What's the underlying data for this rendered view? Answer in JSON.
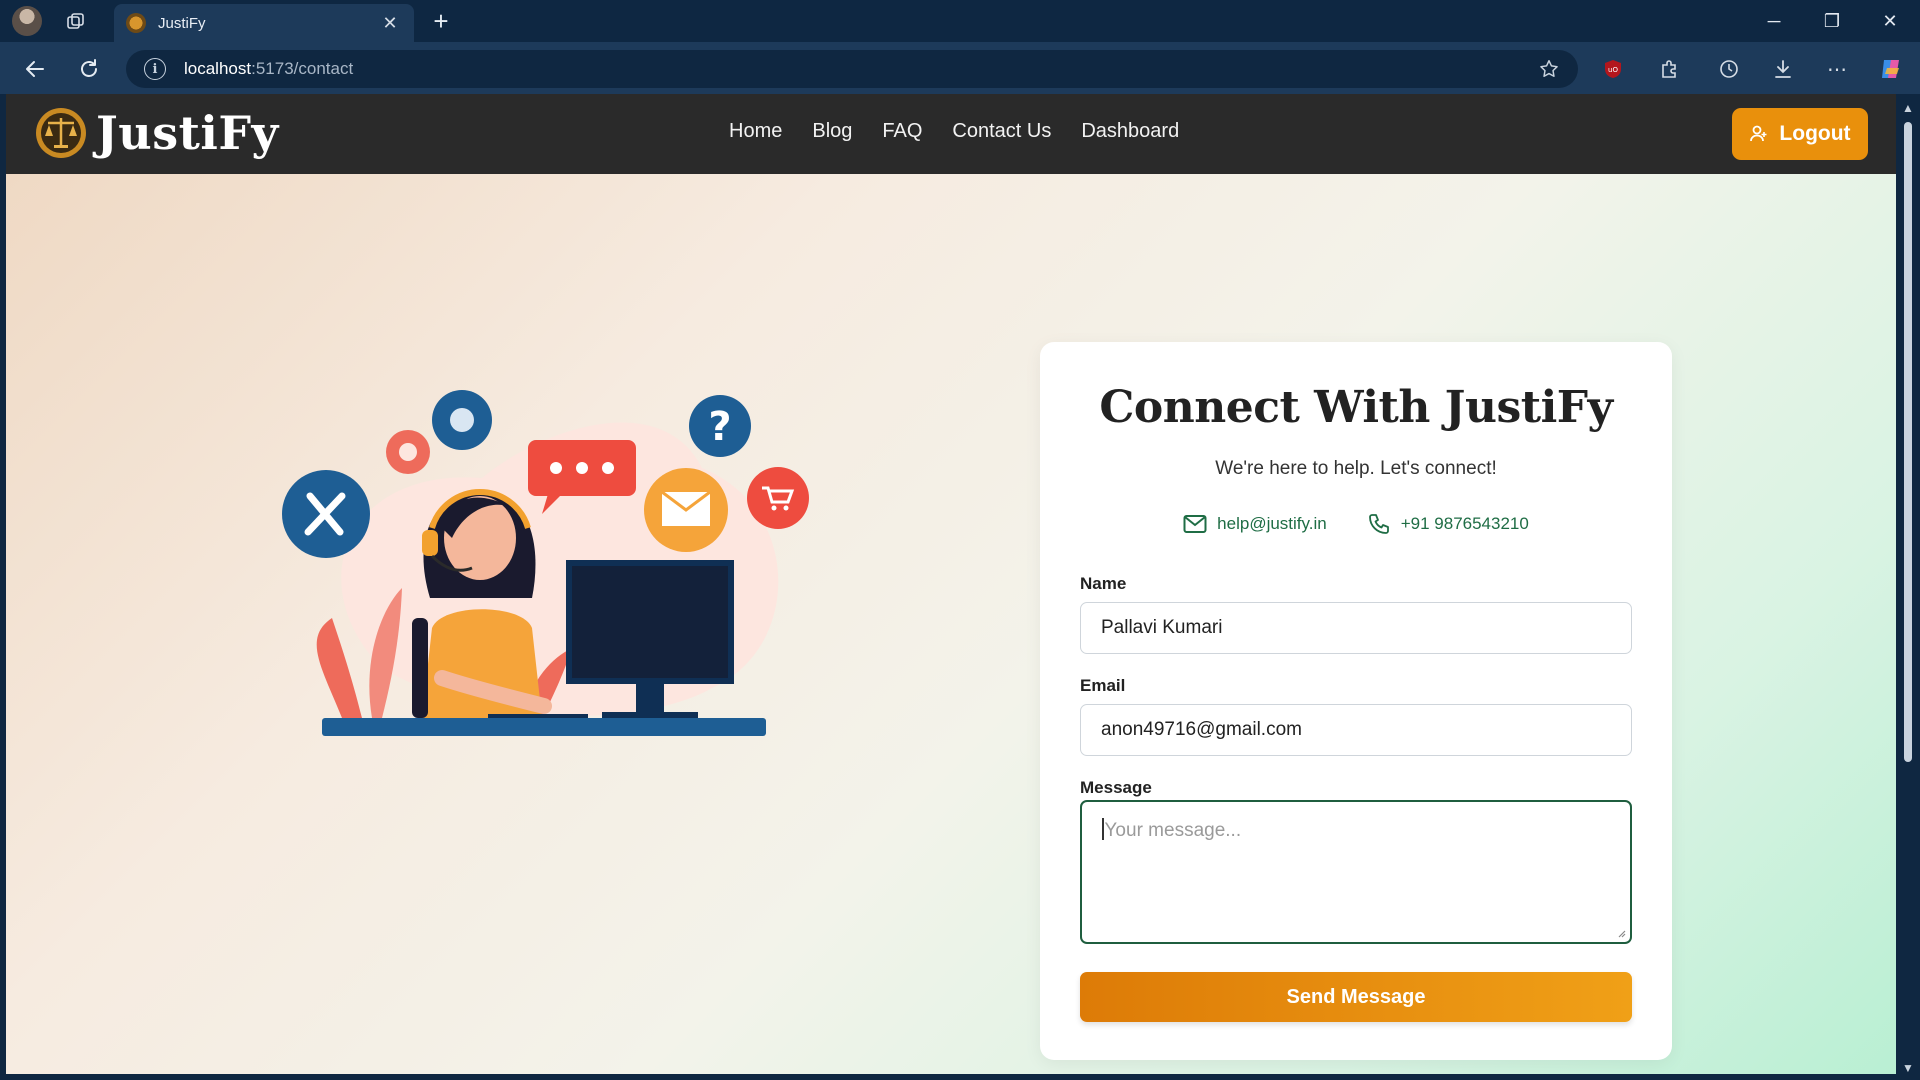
{
  "browser": {
    "tab_title": "JustiFy",
    "tab_close": "✕",
    "new_tab": "+",
    "url_host": "localhost",
    "url_path": ":5173/contact",
    "window_controls": {
      "minimize": "─",
      "restore": "❐",
      "close": "✕"
    },
    "extensions": [
      "ublock-icon",
      "extensions-icon",
      "history-icon",
      "download-icon",
      "more-icon",
      "copilot-icon"
    ]
  },
  "navbar": {
    "brand": "JustiFy",
    "links": [
      "Home",
      "Blog",
      "FAQ",
      "Contact Us",
      "Dashboard"
    ],
    "logout_label": "Logout"
  },
  "contact_card": {
    "title": "Connect With JustiFy",
    "subtitle": "We're here to help. Let's connect!",
    "email": "help@justify.in",
    "phone": "+91 9876543210",
    "name_label": "Name",
    "name_value": "Pallavi Kumari",
    "email_label": "Email",
    "email_value": "anon49716@gmail.com",
    "message_label": "Message",
    "message_placeholder": "Your message...",
    "submit_label": "Send Message"
  },
  "colors": {
    "navbar_bg": "#2a2a2a",
    "accent_orange": "#e9900c",
    "contact_green": "#1f6d45",
    "browser_bg": "#0e2742"
  }
}
